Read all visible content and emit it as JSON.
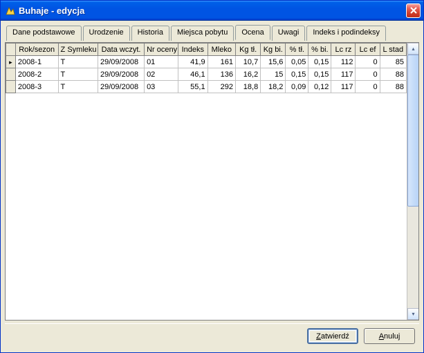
{
  "window": {
    "title": "Buhaje - edycja"
  },
  "tabs": [
    {
      "label": "Dane podstawowe"
    },
    {
      "label": "Urodzenie"
    },
    {
      "label": "Historia"
    },
    {
      "label": "Miejsca pobytu"
    },
    {
      "label": "Ocena"
    },
    {
      "label": "Uwagi"
    },
    {
      "label": "Indeks i podindeksy"
    }
  ],
  "activeTab": 4,
  "grid": {
    "columns": [
      "Rok/sezon",
      "Z Symleku",
      "Data wczyt.",
      "Nr oceny",
      "Indeks",
      "Mleko",
      "Kg tł.",
      "Kg bi.",
      "% tł.",
      "% bi.",
      "Lc rz",
      "Lc ef",
      "L stad"
    ],
    "rows": [
      {
        "current": true,
        "selected": true,
        "cells": [
          "2008-1",
          "T",
          "29/09/2008",
          "01",
          "41,9",
          "161",
          "10,7",
          "15,6",
          "0,05",
          "0,15",
          "112",
          "0",
          "85"
        ]
      },
      {
        "current": false,
        "selected": false,
        "cells": [
          "2008-2",
          "T",
          "29/09/2008",
          "02",
          "46,1",
          "136",
          "16,2",
          "15",
          "0,15",
          "0,15",
          "117",
          "0",
          "88"
        ]
      },
      {
        "current": false,
        "selected": false,
        "cells": [
          "2008-3",
          "T",
          "29/09/2008",
          "03",
          "55,1",
          "292",
          "18,8",
          "18,2",
          "0,09",
          "0,12",
          "117",
          "0",
          "88"
        ]
      }
    ]
  },
  "buttons": {
    "confirm": "Zatwierdź",
    "cancel": "Anuluj"
  }
}
